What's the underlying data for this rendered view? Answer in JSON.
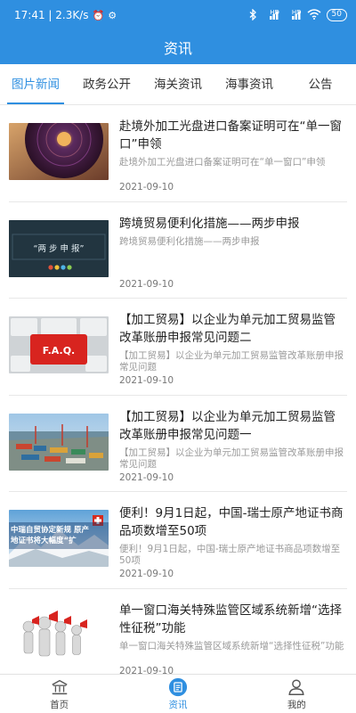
{
  "status_bar": {
    "time_speed": "17:41 | 2.3K/s",
    "net1": "HD",
    "net2": "HD",
    "battery": "50"
  },
  "app_bar": {
    "title": "资讯"
  },
  "tabs": [
    {
      "label": "图片新闻",
      "active": true
    },
    {
      "label": "政务公开",
      "active": false
    },
    {
      "label": "海关资讯",
      "active": false
    },
    {
      "label": "海事资讯",
      "active": false
    },
    {
      "label": "公告",
      "active": false
    }
  ],
  "news": [
    {
      "title": "赴境外加工光盘进口备案证明可在“单一窗口”申领",
      "summary": "赴境外加工光盘进口备案证明可在“单一窗口”申领",
      "date": "2021-09-10"
    },
    {
      "title": "跨境贸易便利化措施——两步申报",
      "summary": "跨境贸易便利化措施——两步申报",
      "date": "2021-09-10",
      "thumb_text": "“两 步 申 报”"
    },
    {
      "title": "【加工贸易】以企业为单元加工贸易监管改革账册申报常见问题二",
      "summary": "【加工贸易】以企业为单元加工贸易监管改革账册申报常见问题",
      "date": "2021-09-10",
      "thumb_text": "F.A.Q."
    },
    {
      "title": "【加工贸易】以企业为单元加工贸易监管改革账册申报常见问题一",
      "summary": "【加工贸易】以企业为单元加工贸易监管改革账册申报常见问题",
      "date": "2021-09-10"
    },
    {
      "title": "便利！9月1日起，中国-瑞士原产地证书商品项数增至50项",
      "summary": "便利！9月1日起，中国-瑞士原产地证书商品项数增至50项",
      "date": "2021-09-10",
      "thumb_text": "中瑞自贸协定新规 原产地证书将大幅度“扩"
    },
    {
      "title": "单一窗口海关特殊监管区域系统新增“选择性征税”功能",
      "summary": "单一窗口海关特殊监管区域系统新增“选择性征税”功能",
      "date": "2021-09-10"
    }
  ],
  "bottom_nav": [
    {
      "label": "首页",
      "icon": "home-icon",
      "active": false
    },
    {
      "label": "资讯",
      "icon": "news-icon",
      "active": true
    },
    {
      "label": "我的",
      "icon": "person-icon",
      "active": false
    }
  ],
  "colors": {
    "primary": "#2f8fe0",
    "divider": "#e8e8e8",
    "summary": "#999999"
  }
}
